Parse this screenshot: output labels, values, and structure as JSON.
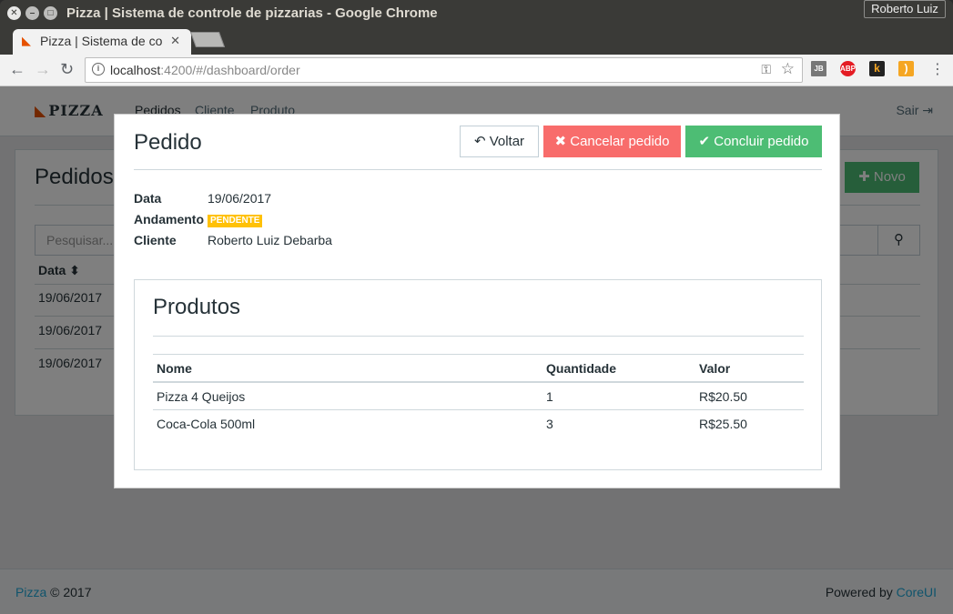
{
  "window": {
    "title": "Pizza | Sistema de controle de pizzarias - Google Chrome",
    "profile": "Roberto Luiz"
  },
  "tab": {
    "title": "Pizza | Sistema de co",
    "favicon": "pizza-icon"
  },
  "address_bar": {
    "host": "localhost",
    "path": ":4200/#/dashboard/order"
  },
  "extensions": [
    "jb-icon",
    "abp-icon",
    "k-icon",
    "rss-icon"
  ],
  "app": {
    "brand": "PIZZA",
    "nav": [
      "Pedidos",
      "Cliente",
      "Produto"
    ],
    "logout": "Sair",
    "page_title": "Pedidos",
    "new_button": "Novo",
    "search_placeholder": "Pesquisar...",
    "table_header": "Data",
    "rows": [
      "19/06/2017",
      "19/06/2017",
      "19/06/2017"
    ],
    "footer_brand": "Pizza",
    "footer_year": "© 2017",
    "footer_powered": "Powered by",
    "footer_powered_link": "CoreUI"
  },
  "modal": {
    "title": "Pedido",
    "back_button": "Voltar",
    "cancel_button": "Cancelar pedido",
    "confirm_button": "Concluir pedido",
    "date_label": "Data",
    "date_value": "19/06/2017",
    "status_label": "Andamento",
    "status_value": "PENDENTE",
    "client_label": "Cliente",
    "client_value": "Roberto Luiz Debarba",
    "products": {
      "title": "Produtos",
      "columns": [
        "Nome",
        "Quantidade",
        "Valor"
      ],
      "rows": [
        {
          "name": "Pizza 4 Queijos",
          "qty": "1",
          "value": "R$20.50"
        },
        {
          "name": "Coca-Cola 500ml",
          "qty": "3",
          "value": "R$25.50"
        }
      ]
    }
  },
  "colors": {
    "success": "#4dbd74",
    "danger": "#f86c6b",
    "warning": "#ffc107",
    "link": "#20a8d8"
  }
}
